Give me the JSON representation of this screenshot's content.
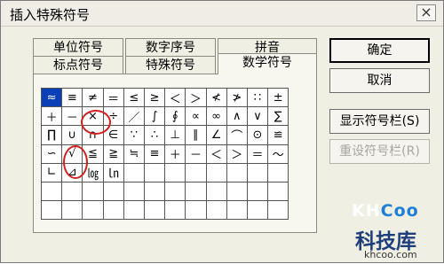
{
  "window": {
    "title": "插入特殊符号",
    "close_glyph": "×"
  },
  "tabs": {
    "unit": "单位符号",
    "number_seq": "数字序号",
    "pinyin": "拼音",
    "punctuation": "标点符号",
    "special": "特殊符号",
    "math": "数学符号"
  },
  "grid": {
    "rows": [
      [
        "≈",
        "≡",
        "≠",
        "＝",
        "≤",
        "≥",
        "＜",
        "＞",
        "≮",
        "≯",
        "∷",
        "±"
      ],
      [
        "＋",
        "－",
        "×",
        "÷",
        "／",
        "∫",
        "∮",
        "∝",
        "∞",
        "∧",
        "∨",
        "∑"
      ],
      [
        "∏",
        "∪",
        "∩",
        "∈",
        "∵",
        "∴",
        "⊥",
        "∥",
        "∠",
        "⌒",
        "⊙",
        "≌"
      ],
      [
        "∽",
        "√",
        "≦",
        "≧",
        "≒",
        "≡",
        "＋",
        "－",
        "＜",
        "＞",
        "＝",
        "～"
      ],
      [
        "∟",
        "⊿",
        "㏒",
        "㏑",
        "",
        "",
        "",
        "",
        "",
        "",
        "",
        ""
      ],
      [
        "",
        "",
        "",
        "",
        "",
        "",
        "",
        "",
        "",
        "",
        "",
        ""
      ],
      [
        "",
        "",
        "",
        "",
        "",
        "",
        "",
        "",
        "",
        "",
        "",
        ""
      ]
    ],
    "selected": "≈"
  },
  "buttons": {
    "ok": "确定",
    "cancel": "取消",
    "show_bar": "显示符号栏(S)",
    "reset_bar": "重设符号栏(R)"
  },
  "watermark": {
    "logo_a": "KH",
    "logo_b": "Coo",
    "name": "科技库",
    "url": "khcoo.com"
  },
  "colors": {
    "selected_cell": "#0a3fb8",
    "annotation_circle": "#d1201c"
  }
}
